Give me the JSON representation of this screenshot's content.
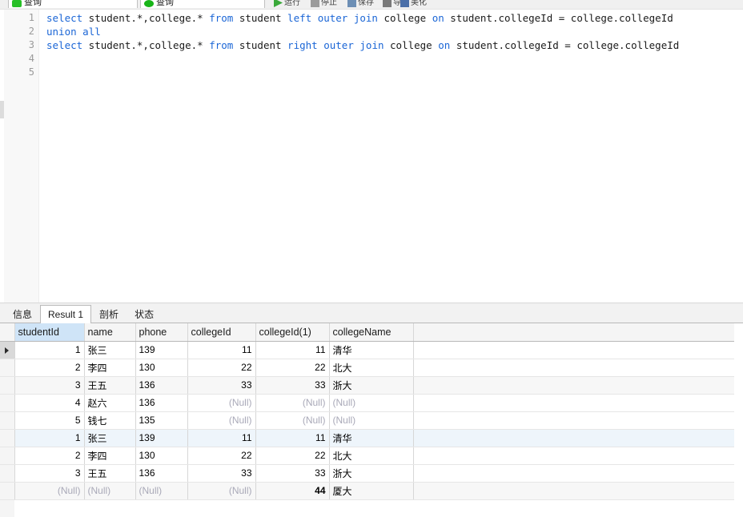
{
  "toolbar": {
    "tabs": [
      {
        "label": "查询",
        "icon": "query-tab-icon"
      },
      {
        "label": "查询",
        "icon": "query-tab-icon-2"
      }
    ],
    "buttons": [
      {
        "label": "运行",
        "icon": "run-icon"
      },
      {
        "label": "停止",
        "icon": "stop-icon"
      },
      {
        "label": "保存",
        "icon": "save-icon"
      },
      {
        "label": "导出",
        "icon": "export-icon"
      },
      {
        "label": "美化",
        "icon": "beautify-icon"
      }
    ]
  },
  "editor": {
    "line_numbers": [
      "1",
      "2",
      "3",
      "4",
      "5"
    ],
    "lines": [
      {
        "number": "1",
        "tokens": [
          {
            "t": "select",
            "k": true
          },
          {
            "t": " student.*,college.* ",
            "k": false
          },
          {
            "t": "from",
            "k": true
          },
          {
            "t": " student ",
            "k": false
          },
          {
            "t": "left",
            "k": true
          },
          {
            "t": " ",
            "k": false
          },
          {
            "t": "outer",
            "k": true
          },
          {
            "t": " ",
            "k": false
          },
          {
            "t": "join",
            "k": true
          },
          {
            "t": " college ",
            "k": false
          },
          {
            "t": "on",
            "k": true
          },
          {
            "t": " student.collegeId = college.collegeId",
            "k": false
          }
        ]
      },
      {
        "number": "2",
        "tokens": [
          {
            "t": "union",
            "k": true
          },
          {
            "t": " ",
            "k": false
          },
          {
            "t": "all",
            "k": true
          }
        ]
      },
      {
        "number": "3",
        "tokens": [
          {
            "t": "select",
            "k": true
          },
          {
            "t": " student.*,college.* ",
            "k": false
          },
          {
            "t": "from",
            "k": true
          },
          {
            "t": " student ",
            "k": false
          },
          {
            "t": "right",
            "k": true
          },
          {
            "t": " ",
            "k": false
          },
          {
            "t": "outer",
            "k": true
          },
          {
            "t": " ",
            "k": false
          },
          {
            "t": "join",
            "k": true
          },
          {
            "t": " college ",
            "k": false
          },
          {
            "t": "on",
            "k": true
          },
          {
            "t": " student.collegeId = college.collegeId",
            "k": false
          }
        ]
      },
      {
        "number": "4",
        "tokens": []
      },
      {
        "number": "5",
        "tokens": []
      }
    ]
  },
  "result_panel": {
    "tabs": [
      {
        "label": "信息",
        "active": false
      },
      {
        "label": "Result 1",
        "active": true
      },
      {
        "label": "剖析",
        "active": false
      },
      {
        "label": "状态",
        "active": false
      }
    ],
    "grid": {
      "columns": [
        {
          "label": "studentId",
          "align": "num",
          "selected": true
        },
        {
          "label": "name",
          "align": "txt",
          "selected": false
        },
        {
          "label": "phone",
          "align": "txt",
          "selected": false
        },
        {
          "label": "collegeId",
          "align": "num",
          "selected": false
        },
        {
          "label": "collegeId(1)",
          "align": "num",
          "selected": false
        },
        {
          "label": "collegeName",
          "align": "txt",
          "selected": false
        }
      ],
      "null_label": "(Null)",
      "rows": [
        {
          "current": true,
          "style": "",
          "cells": [
            "1",
            "张三",
            "139",
            "11",
            "11",
            "清华"
          ]
        },
        {
          "current": false,
          "style": "",
          "cells": [
            "2",
            "李四",
            "130",
            "22",
            "22",
            "北大"
          ]
        },
        {
          "current": false,
          "style": "stripe",
          "cells": [
            "3",
            "王五",
            "136",
            "33",
            "33",
            "浙大"
          ]
        },
        {
          "current": false,
          "style": "",
          "cells": [
            "4",
            "赵六",
            "136",
            "(Null)",
            "(Null)",
            "(Null)"
          ]
        },
        {
          "current": false,
          "style": "",
          "cells": [
            "5",
            "钱七",
            "135",
            "(Null)",
            "(Null)",
            "(Null)"
          ]
        },
        {
          "current": false,
          "style": "hl",
          "cells": [
            "1",
            "张三",
            "139",
            "11",
            "11",
            "清华"
          ]
        },
        {
          "current": false,
          "style": "",
          "cells": [
            "2",
            "李四",
            "130",
            "22",
            "22",
            "北大"
          ]
        },
        {
          "current": false,
          "style": "",
          "cells": [
            "3",
            "王五",
            "136",
            "33",
            "33",
            "浙大"
          ]
        },
        {
          "current": false,
          "style": "stripe",
          "cells": [
            "(Null)",
            "(Null)",
            "(Null)",
            "(Null)",
            "44",
            "厦大"
          ]
        }
      ]
    }
  },
  "colors": {
    "keyword": "#1b66d6",
    "null_text": "#a9a9b8",
    "header_selected": "#cfe4f7",
    "row_highlight": "#eef5fb",
    "row_stripe": "#f7f7f7"
  }
}
